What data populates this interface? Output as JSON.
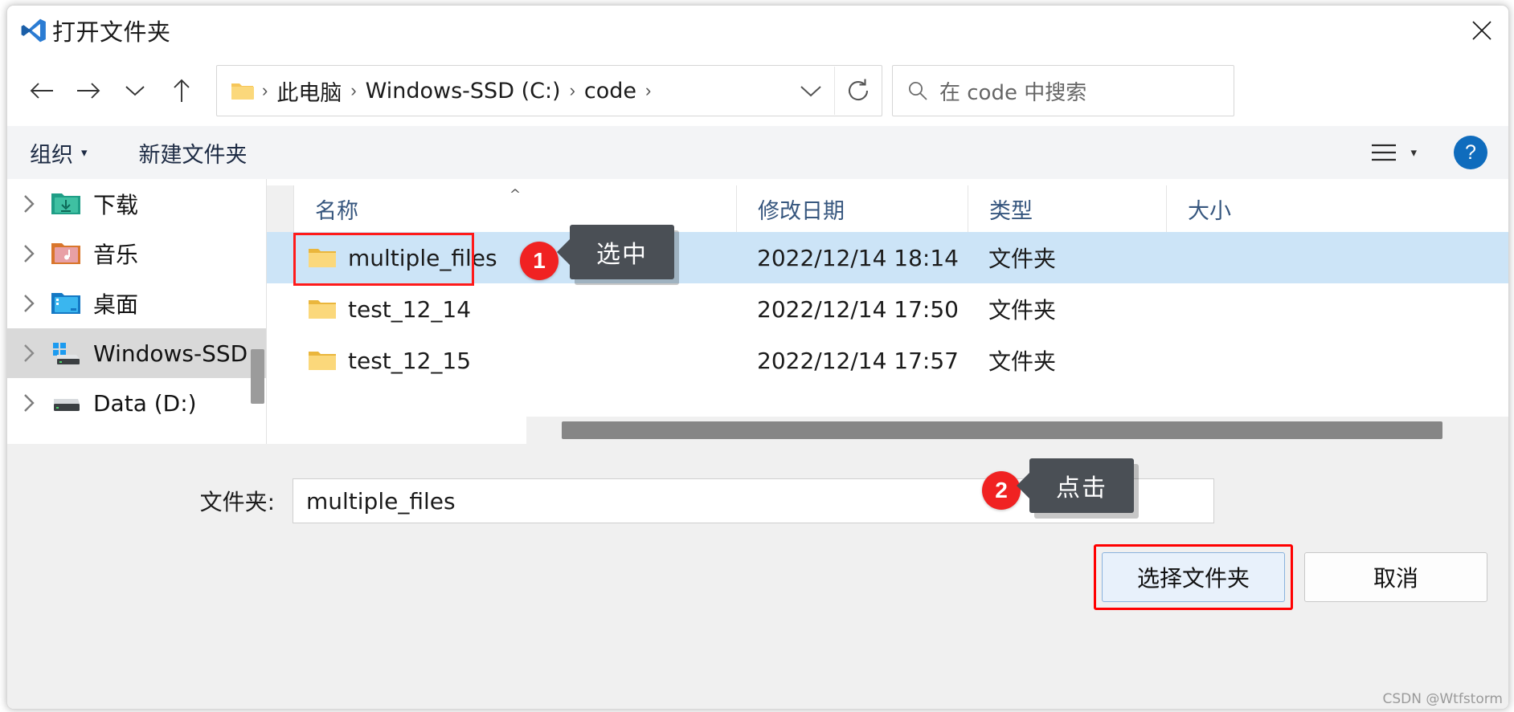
{
  "window": {
    "title": "打开文件夹",
    "logo_icon": "vscode-logo",
    "close_icon": "close-icon"
  },
  "nav": {
    "back_icon": "arrow-left-icon",
    "forward_icon": "arrow-right-icon",
    "recent_icon": "chevron-down-icon",
    "up_icon": "arrow-up-icon",
    "address": {
      "folder_icon": "folder-icon",
      "separator": "›",
      "crumbs": [
        "此电脑",
        "Windows-SSD (C:)",
        "code"
      ],
      "dropdown_icon": "chevron-down-icon",
      "refresh_icon": "refresh-icon"
    },
    "search": {
      "icon": "search-icon",
      "placeholder": "在 code 中搜索",
      "value": ""
    }
  },
  "toolbar": {
    "organize_label": "组织",
    "organize_caret": "▾",
    "new_folder_label": "新建文件夹",
    "view_icon": "list-view-icon",
    "view_caret": "▾",
    "help_label": "?"
  },
  "sidebar": {
    "items": [
      {
        "label": "下载",
        "icon": "downloads-folder-icon",
        "selected": false
      },
      {
        "label": "音乐",
        "icon": "music-folder-icon",
        "selected": false
      },
      {
        "label": "桌面",
        "icon": "desktop-folder-icon",
        "selected": false
      },
      {
        "label": "Windows-SSD",
        "icon": "windows-drive-icon",
        "selected": true
      },
      {
        "label": "Data (D:)",
        "icon": "drive-icon",
        "selected": false
      }
    ]
  },
  "filelist": {
    "columns": [
      "名称",
      "修改日期",
      "类型",
      "大小"
    ],
    "sort_column": "名称",
    "sort_caret": "^",
    "rows": [
      {
        "name": "multiple_files",
        "date": "2022/12/14 18:14",
        "type": "文件夹",
        "size": "",
        "selected": true
      },
      {
        "name": "test_12_14",
        "date": "2022/12/14 17:50",
        "type": "文件夹",
        "size": "",
        "selected": false
      },
      {
        "name": "test_12_15",
        "date": "2022/12/14 17:57",
        "type": "文件夹",
        "size": "",
        "selected": false
      }
    ]
  },
  "bottom": {
    "folder_label": "文件夹:",
    "folder_value": "multiple_files",
    "select_button": "选择文件夹",
    "cancel_button": "取消"
  },
  "annotations": [
    {
      "badge": "1",
      "text": "选中"
    },
    {
      "badge": "2",
      "text": "点击"
    }
  ],
  "watermark": "CSDN @Wtfstorm",
  "colors": {
    "accent_red": "#f02222",
    "selection_blue": "#cce4f7",
    "callout_gray": "#4a4f55",
    "header_blue": "#36567e"
  }
}
